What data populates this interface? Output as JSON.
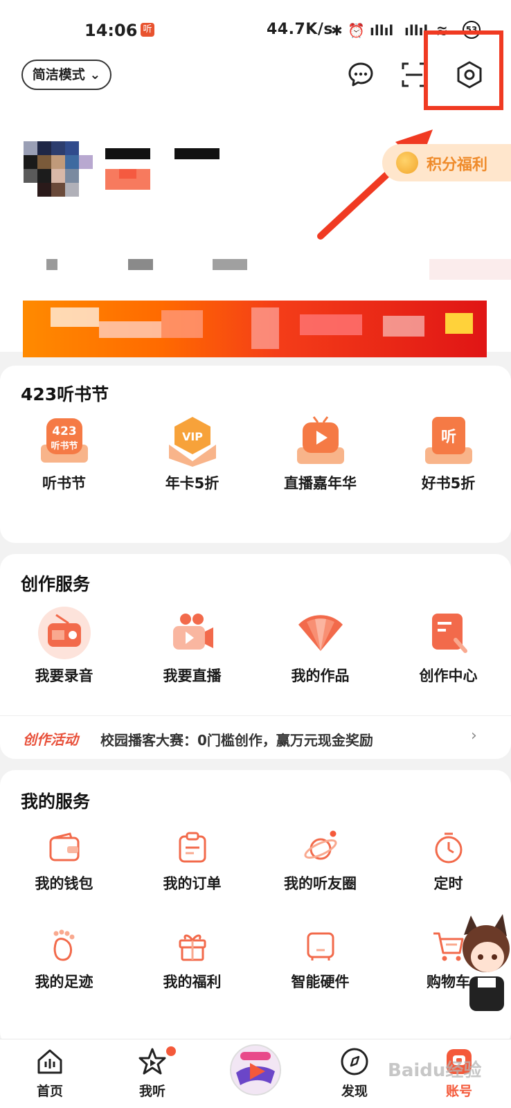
{
  "status_bar": {
    "time": "14:06",
    "app_badge": "听",
    "net_speed": "44.7K/s",
    "battery": "53"
  },
  "header": {
    "mode_button": "简洁模式 ⌄",
    "icons": [
      "message-icon",
      "scan-icon",
      "settings-icon"
    ]
  },
  "profile": {
    "points_button": "积分福利"
  },
  "festival": {
    "title": "423听书节",
    "items": [
      {
        "label": "听书节",
        "icon": "festival-423-icon"
      },
      {
        "label": "年卡5折",
        "icon": "vip-icon"
      },
      {
        "label": "直播嘉年华",
        "icon": "live-tv-icon"
      },
      {
        "label": "好书5折",
        "icon": "book-icon"
      }
    ]
  },
  "creation": {
    "title": "创作服务",
    "items": [
      {
        "label": "我要录音",
        "icon": "radio-icon"
      },
      {
        "label": "我要直播",
        "icon": "video-camera-icon"
      },
      {
        "label": "我的作品",
        "icon": "fan-icon"
      },
      {
        "label": "创作中心",
        "icon": "document-edit-icon"
      }
    ],
    "activity_tag": "创作活动",
    "activity_text": "校园播客大赛：0门槛创作，赢万元现金奖励"
  },
  "services": {
    "title": "我的服务",
    "items": [
      {
        "label": "我的钱包",
        "icon": "wallet-icon"
      },
      {
        "label": "我的订单",
        "icon": "order-icon"
      },
      {
        "label": "我的听友圈",
        "icon": "planet-icon"
      },
      {
        "label": "定时",
        "icon": "timer-icon"
      },
      {
        "label": "我的足迹",
        "icon": "footprint-icon"
      },
      {
        "label": "我的福利",
        "icon": "gift-icon"
      },
      {
        "label": "智能硬件",
        "icon": "device-icon"
      },
      {
        "label": "购物车",
        "icon": "cart-icon"
      }
    ]
  },
  "bottom_nav": {
    "items": [
      {
        "label": "首页",
        "icon": "home-icon"
      },
      {
        "label": "我听",
        "icon": "star-play-icon"
      },
      {
        "label": "",
        "icon": "center-logo-icon"
      },
      {
        "label": "发现",
        "icon": "discover-icon"
      },
      {
        "label": "账号",
        "icon": "account-icon"
      }
    ]
  },
  "watermark": "Baidu经验",
  "colors": {
    "accent": "#f4593a",
    "highlight": "#f03a22",
    "points_bg": "#ffe6cc",
    "points_text": "#ef8b2b"
  }
}
